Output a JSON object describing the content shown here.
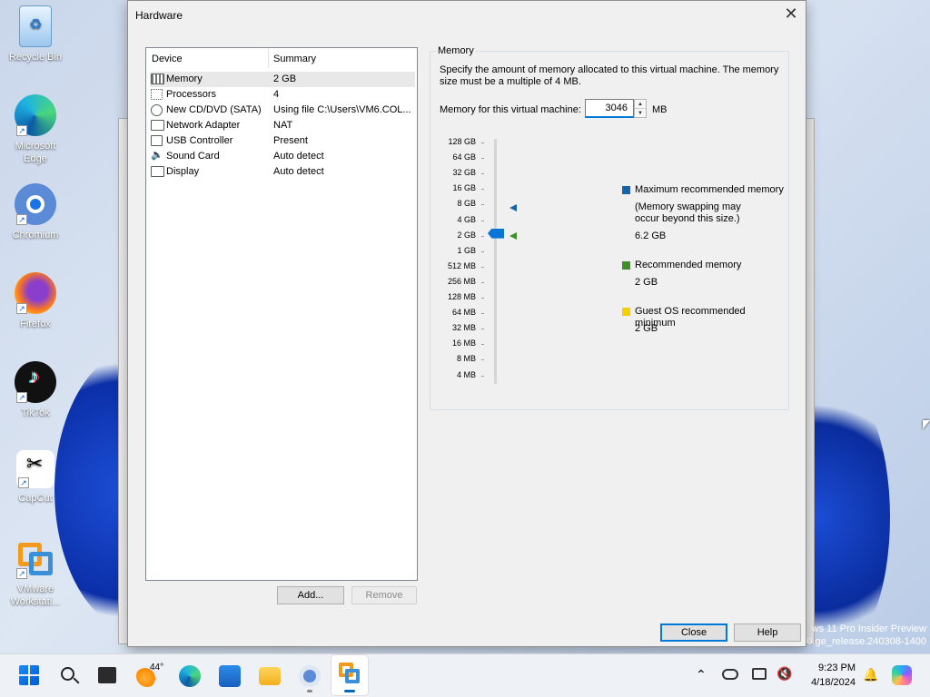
{
  "desktop": {
    "icons": [
      {
        "name": "recycle-bin-icon",
        "label": "Recycle Bin"
      },
      {
        "name": "microsoft-edge-icon",
        "label": "Microsoft Edge"
      },
      {
        "name": "chromium-icon",
        "label": "Chromium"
      },
      {
        "name": "firefox-icon",
        "label": "Firefox"
      },
      {
        "name": "tiktok-icon",
        "label": "TikTok"
      },
      {
        "name": "capcut-icon",
        "label": "CapCut"
      },
      {
        "name": "vmware-workstation-icon",
        "label": "VMware Workstati..."
      }
    ],
    "watermark_line1": "ws 11 Pro Insider Preview",
    "watermark_line2": "0.ge_release.240308-1400"
  },
  "dialog": {
    "title": "Hardware",
    "close_icon": "close-icon",
    "device_list": {
      "col_device": "Device",
      "col_summary": "Summary",
      "rows": [
        {
          "icon": "memory-icon",
          "device": "Memory",
          "summary": "2 GB",
          "selected": true
        },
        {
          "icon": "processor-icon",
          "device": "Processors",
          "summary": "4"
        },
        {
          "icon": "cd-dvd-icon",
          "device": "New CD/DVD (SATA)",
          "summary": "Using file C:\\Users\\VM6.COL..."
        },
        {
          "icon": "network-adapter-icon",
          "device": "Network Adapter",
          "summary": "NAT"
        },
        {
          "icon": "usb-controller-icon",
          "device": "USB Controller",
          "summary": "Present"
        },
        {
          "icon": "sound-card-icon",
          "device": "Sound Card",
          "summary": "Auto detect"
        },
        {
          "icon": "display-icon",
          "device": "Display",
          "summary": "Auto detect"
        }
      ]
    },
    "add_label": "Add...",
    "remove_label": "Remove",
    "close_label": "Close",
    "help_label": "Help",
    "memory": {
      "group_title": "Memory",
      "description": "Specify the amount of memory allocated to this virtual machine. The memory size must be a multiple of 4 MB.",
      "field_label": "Memory for this virtual machine:",
      "field_value": "3046",
      "unit": "MB",
      "scale": [
        "128 GB",
        "64 GB",
        "32 GB",
        "16 GB",
        "8 GB",
        "4 GB",
        "2 GB",
        "1 GB",
        "512 MB",
        "256 MB",
        "128 MB",
        "64 MB",
        "32 MB",
        "16 MB",
        "8 MB",
        "4 MB"
      ],
      "legend": {
        "max_title": "Maximum recommended memory",
        "max_note": "(Memory swapping may occur beyond this size.)",
        "max_value": "6.2 GB",
        "rec_title": "Recommended memory",
        "rec_value": "2 GB",
        "min_title": "Guest OS recommended minimum",
        "min_value": "2 GB"
      },
      "colors": {
        "max": "#1565a8",
        "rec": "#3e8f2a",
        "min": "#f5d000",
        "thumb": "#0a75d6"
      }
    }
  },
  "taskbar": {
    "weather_temp": "44°",
    "time": "9:23 PM",
    "date": "4/18/2024",
    "icons": [
      "start-icon",
      "search-icon",
      "task-view-icon",
      "weather-icon",
      "edge-icon",
      "store-icon",
      "file-explorer-icon",
      "chromium-icon",
      "vmware-icon"
    ],
    "tray_icons": [
      "chevron-up-icon",
      "onedrive-icon",
      "display-icon",
      "volume-muted-icon",
      "notification-bell-icon",
      "copilot-icon"
    ]
  }
}
